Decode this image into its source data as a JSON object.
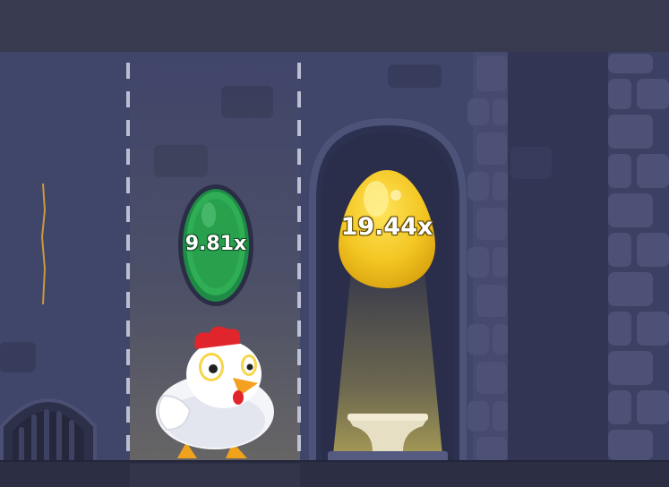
{
  "game": {
    "current_multiplier": "9.81x",
    "next_multiplier": "19.44x"
  },
  "colors": {
    "wall": "#40456a",
    "coin_green": "#2fae55",
    "egg_gold": "#f3c623",
    "arch_glow": "#d8c65a"
  },
  "icons": {
    "player": "chicken-icon",
    "reward": "golden-egg-icon",
    "token": "green-coin-icon",
    "drain": "sewer-grate-icon"
  }
}
